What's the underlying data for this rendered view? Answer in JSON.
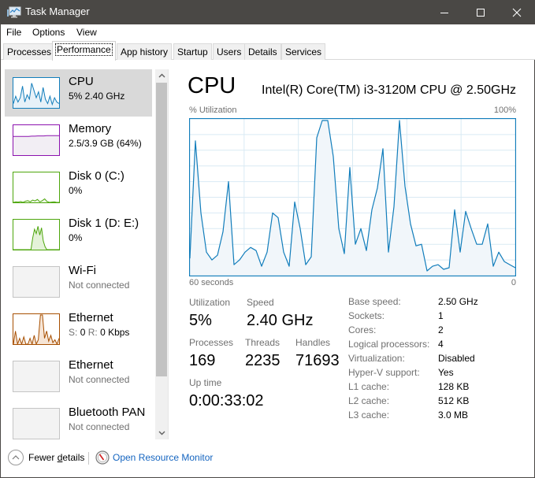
{
  "window": {
    "title": "Task Manager",
    "controls": [
      "minimize",
      "maximize",
      "close"
    ]
  },
  "menu": [
    "File",
    "Options",
    "View"
  ],
  "tabs": [
    {
      "label": "Processes",
      "active": false
    },
    {
      "label": "Performance",
      "active": true
    },
    {
      "label": "App history",
      "active": false
    },
    {
      "label": "Startup",
      "active": false
    },
    {
      "label": "Users",
      "active": false
    },
    {
      "label": "Details",
      "active": false
    },
    {
      "label": "Services",
      "active": false
    }
  ],
  "sidebar": {
    "items": [
      {
        "name": "CPU",
        "sub": "5%  2.40 GHz",
        "kind": "cpu",
        "color": "#117dbb",
        "selected": true
      },
      {
        "name": "Memory",
        "sub": "2.5/3.9 GB (64%)",
        "kind": "memory",
        "color": "#8b12ae",
        "selected": false
      },
      {
        "name": "Disk 0 (C:)",
        "sub": "0%",
        "kind": "disk0",
        "color": "#4da60c",
        "selected": false
      },
      {
        "name": "Disk 1 (D: E:)",
        "sub": "0%",
        "kind": "disk1",
        "color": "#4da60c",
        "selected": false
      },
      {
        "name": "Wi-Fi",
        "sub": "Not connected",
        "kind": "empty",
        "selected": false
      },
      {
        "name": "Ethernet",
        "sub_send_label": "S:",
        "sub_send": "0",
        "sub_recv_label": "R:",
        "sub_recv": "0 Kbps",
        "kind": "ethernet",
        "color": "#a74f01",
        "selected": false
      },
      {
        "name": "Ethernet",
        "sub": "Not connected",
        "kind": "empty",
        "selected": false
      },
      {
        "name": "Bluetooth PAN",
        "sub": "Not connected",
        "kind": "empty",
        "selected": false
      }
    ],
    "thumb_series": {
      "cpu": [
        15,
        40,
        20,
        35,
        75,
        20,
        45,
        30,
        85,
        60,
        35,
        55,
        20,
        70,
        30,
        15,
        40,
        12,
        35,
        20,
        15
      ],
      "memory": [
        64,
        64,
        64,
        64,
        64,
        64,
        65,
        65,
        66,
        66,
        66,
        67,
        67,
        67,
        67,
        67
      ],
      "disk0": [
        0,
        2,
        1,
        3,
        0,
        4,
        6,
        2,
        8,
        5,
        10,
        2,
        6,
        12,
        3,
        0,
        1,
        2,
        0,
        0
      ],
      "disk1": [
        0,
        0,
        0,
        0,
        0,
        0,
        0,
        0,
        0,
        0,
        0,
        40,
        70,
        55,
        80,
        50,
        75,
        30,
        10,
        0,
        0,
        0,
        0,
        0,
        0,
        0,
        0
      ],
      "ethernet": [
        0,
        45,
        0,
        20,
        0,
        25,
        0,
        0,
        20,
        0,
        30,
        0,
        15,
        100,
        100,
        20,
        45,
        10,
        30,
        5,
        15,
        0,
        20
      ]
    }
  },
  "main": {
    "title": "CPU",
    "model": "Intel(R) Core(TM) i3-3120M CPU @ 2.50GHz",
    "graph": {
      "y_label": "% Utilization",
      "y_max_label": "100%",
      "x_left_label": "60 seconds",
      "x_right_label": "0",
      "line_color": "#117dbb",
      "fill_color": "#f1f6fa",
      "grid_color": "#d9eaf4"
    },
    "stats": {
      "utilization_label": "Utilization",
      "utilization": "5%",
      "speed_label": "Speed",
      "speed": "2.40 GHz",
      "processes_label": "Processes",
      "processes": "169",
      "threads_label": "Threads",
      "threads": "2235",
      "handles_label": "Handles",
      "handles": "71693",
      "uptime_label": "Up time",
      "uptime": "0:00:33:02"
    },
    "specs": [
      {
        "label": "Base speed:",
        "value": "2.50 GHz"
      },
      {
        "label": "Sockets:",
        "value": "1"
      },
      {
        "label": "Cores:",
        "value": "2"
      },
      {
        "label": "Logical processors:",
        "value": "4"
      },
      {
        "label": "Virtualization:",
        "value": "Disabled"
      },
      {
        "label": "Hyper-V support:",
        "value": "Yes"
      },
      {
        "label": "L1 cache:",
        "value": "128 KB"
      },
      {
        "label": "L2 cache:",
        "value": "512 KB"
      },
      {
        "label": "L3 cache:",
        "value": "3.0 MB"
      }
    ]
  },
  "footer": {
    "fewer_details_pre": "Fewer ",
    "fewer_details_accel": "d",
    "fewer_details_post": "etails",
    "resource_monitor": "Open Resource Monitor"
  },
  "chart_data": {
    "type": "area",
    "title": "CPU % Utilization",
    "xlabel": "60 seconds",
    "ylabel": "% Utilization",
    "x_range_seconds_ago": [
      60,
      0
    ],
    "ylim": [
      0,
      100
    ],
    "grid": true,
    "values": [
      11,
      86,
      40,
      15,
      10,
      13,
      28,
      60,
      7,
      10,
      15,
      18,
      16,
      6,
      15,
      40,
      37,
      15,
      6,
      47,
      30,
      7,
      12,
      88,
      99,
      99,
      76,
      30,
      14,
      69,
      20,
      30,
      16,
      42,
      56,
      81,
      15,
      44,
      99,
      57,
      33,
      19,
      20,
      3,
      6,
      7,
      4,
      5,
      42,
      15,
      41,
      30,
      20,
      20,
      33,
      6,
      15,
      9,
      7,
      5
    ]
  }
}
